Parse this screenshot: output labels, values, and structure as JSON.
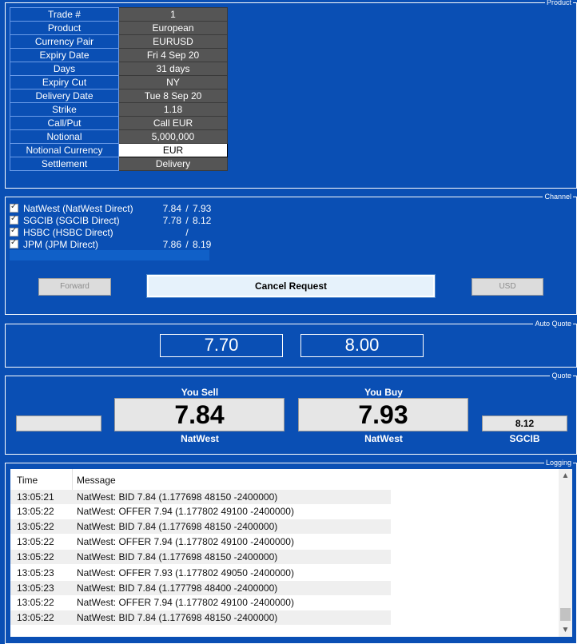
{
  "panels": {
    "product": "Product",
    "channel": "Channel",
    "auto_quote": "Auto Quote",
    "quote": "Quote",
    "logging": "Logging"
  },
  "product": [
    {
      "label": "Trade #",
      "value": "1"
    },
    {
      "label": "Product",
      "value": "European"
    },
    {
      "label": "Currency Pair",
      "value": "EURUSD"
    },
    {
      "label": "Expiry Date",
      "value": "Fri 4 Sep 20"
    },
    {
      "label": "Days",
      "value": "31 days"
    },
    {
      "label": "Expiry Cut",
      "value": "NY"
    },
    {
      "label": "Delivery Date",
      "value": "Tue 8 Sep 20"
    },
    {
      "label": "Strike",
      "value": "1.18"
    },
    {
      "label": "Call/Put",
      "value": "Call EUR"
    },
    {
      "label": "Notional",
      "value": "5,000,000"
    },
    {
      "label": "Notional Currency",
      "value": "EUR"
    },
    {
      "label": "Settlement",
      "value": "Delivery"
    }
  ],
  "channels": [
    {
      "name": "NatWest (NatWest Direct)",
      "bid": "7.84",
      "ask": "7.93",
      "checked": true
    },
    {
      "name": "SGCIB (SGCIB Direct)",
      "bid": "7.78",
      "ask": "8.12",
      "checked": true
    },
    {
      "name": "HSBC (HSBC Direct)",
      "bid": "",
      "ask": "",
      "checked": true
    },
    {
      "name": "JPM (JPM Direct)",
      "bid": "7.86",
      "ask": "8.19",
      "checked": true
    }
  ],
  "channel_sep": "/",
  "buttons": {
    "forward": "Forward",
    "cancel": "Cancel Request",
    "usd": "USD"
  },
  "auto_quote": {
    "bid": "7.70",
    "ask": "8.00"
  },
  "quote": {
    "sell_label": "You Sell",
    "buy_label": "You Buy",
    "sell_value": "7.84",
    "buy_value": "7.93",
    "sell_bank": "NatWest",
    "buy_bank": "NatWest",
    "alt_value": "8.12",
    "alt_bank": "SGCIB"
  },
  "logging": {
    "columns": [
      "Time",
      "Message"
    ],
    "rows": [
      {
        "time": "13:05:21",
        "message": "NatWest: BID 7.84 (1.177698 48150 -2400000)"
      },
      {
        "time": "13:05:22",
        "message": "NatWest: OFFER 7.94 (1.177802 49100 -2400000)"
      },
      {
        "time": "13:05:22",
        "message": "NatWest: BID 7.84 (1.177698 48150 -2400000)"
      },
      {
        "time": "13:05:22",
        "message": "NatWest: OFFER 7.94 (1.177802 49100 -2400000)"
      },
      {
        "time": "13:05:22",
        "message": "NatWest: BID 7.84 (1.177698 48150 -2400000)"
      },
      {
        "time": "13:05:23",
        "message": "NatWest: OFFER 7.93 (1.177802 49050 -2400000)"
      },
      {
        "time": "13:05:23",
        "message": "NatWest: BID 7.84 (1.177798 48400 -2400000)"
      },
      {
        "time": "13:05:22",
        "message": "NatWest: OFFER 7.94 (1.177802 49100 -2400000)"
      },
      {
        "time": "13:05:22",
        "message": "NatWest: BID 7.84 (1.177698 48150 -2400000)"
      }
    ]
  },
  "colors": {
    "background": "#0a4fb4",
    "value_cell": "#555555",
    "text": "#ffffff"
  },
  "icons": {
    "scroll_up": "chevron-up-icon",
    "scroll_down": "chevron-down-icon",
    "checkbox": "checkmark-icon"
  }
}
